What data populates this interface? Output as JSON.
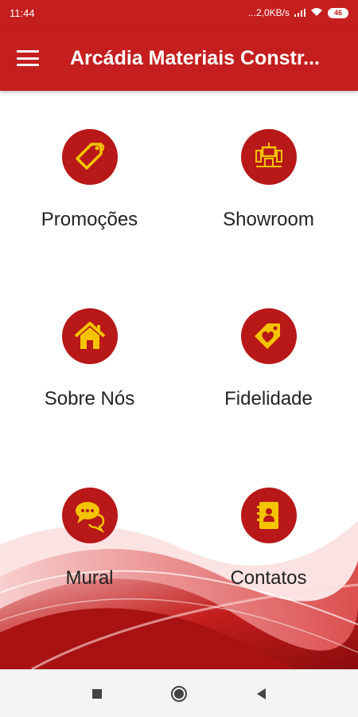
{
  "status_bar": {
    "time": "11:44",
    "network_speed": "...2,0KB/s",
    "battery": "46"
  },
  "app_bar": {
    "title": "Arcádia Materiais Constr...",
    "menu_icon": "hamburger-menu-icon"
  },
  "tiles": [
    {
      "label": "Promoções",
      "icon": "price-tag-icon"
    },
    {
      "label": "Showroom",
      "icon": "showroom-display-icon"
    },
    {
      "label": "Sobre Nós",
      "icon": "house-icon"
    },
    {
      "label": "Fidelidade",
      "icon": "heart-tag-icon"
    },
    {
      "label": "Mural",
      "icon": "chat-bubbles-icon"
    },
    {
      "label": "Contatos",
      "icon": "address-book-icon"
    }
  ],
  "colors": {
    "primary": "#c41e1e",
    "icon_circle": "#b81818",
    "icon_glyph": "#f5c400"
  }
}
